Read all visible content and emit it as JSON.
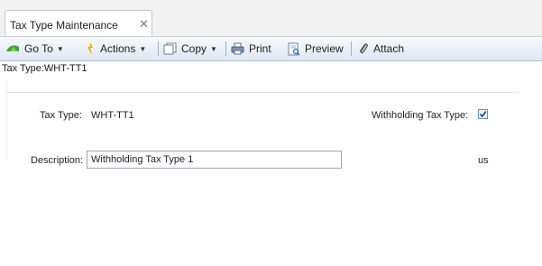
{
  "tab": {
    "title": "Tax Type Maintenance",
    "close_glyph": "✕"
  },
  "toolbar": {
    "goto_label": "Go To",
    "actions_label": "Actions",
    "copy_label": "Copy",
    "print_label": "Print",
    "preview_label": "Preview",
    "attach_label": "Attach",
    "dropdown_glyph": "▼"
  },
  "group": {
    "title": "Tax Type:WHT-TT1"
  },
  "form": {
    "tax_type_label": "Tax Type:",
    "tax_type_value": "WHT-TT1",
    "withholding_label": "Withholding Tax Type:",
    "withholding_checked": true,
    "description_label": "Description:",
    "description_value": "Withholding Tax Type 1",
    "language_code": "us"
  },
  "colors": {
    "accent": "#3c6ea8",
    "toolbar_bg": "#dfe7f2"
  },
  "icons": [
    "goto-icon",
    "actions-icon",
    "copy-icon",
    "print-icon",
    "preview-icon",
    "attach-icon",
    "checkmark-icon"
  ]
}
